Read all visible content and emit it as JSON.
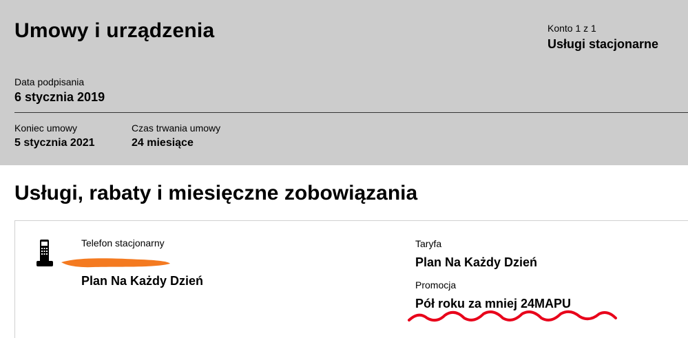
{
  "header": {
    "title": "Umowy i urządzenia",
    "account_counter": "Konto 1 z 1",
    "account_type": "Usługi stacjonarne",
    "signed_label": "Data podpisania",
    "signed_value": "6 stycznia 2019",
    "end_label": "Koniec umowy",
    "end_value": "5 stycznia 2021",
    "duration_label": "Czas trwania umowy",
    "duration_value": "24 miesiące"
  },
  "services": {
    "title": "Usługi, rabaty i miesięczne zobowiązania",
    "item": {
      "icon": "landline-phone-icon",
      "type_label": "Telefon stacjonarny",
      "plan_name": "Plan Na Każdy Dzień",
      "tariff_label": "Taryfa",
      "tariff_value": "Plan Na Każdy Dzień",
      "promo_label": "Promocja",
      "promo_value": "Pół roku za mniej 24MAPU"
    }
  },
  "colors": {
    "header_bg": "#cccccc",
    "redaction": "#f47a20",
    "squiggle": "#e8001a"
  }
}
